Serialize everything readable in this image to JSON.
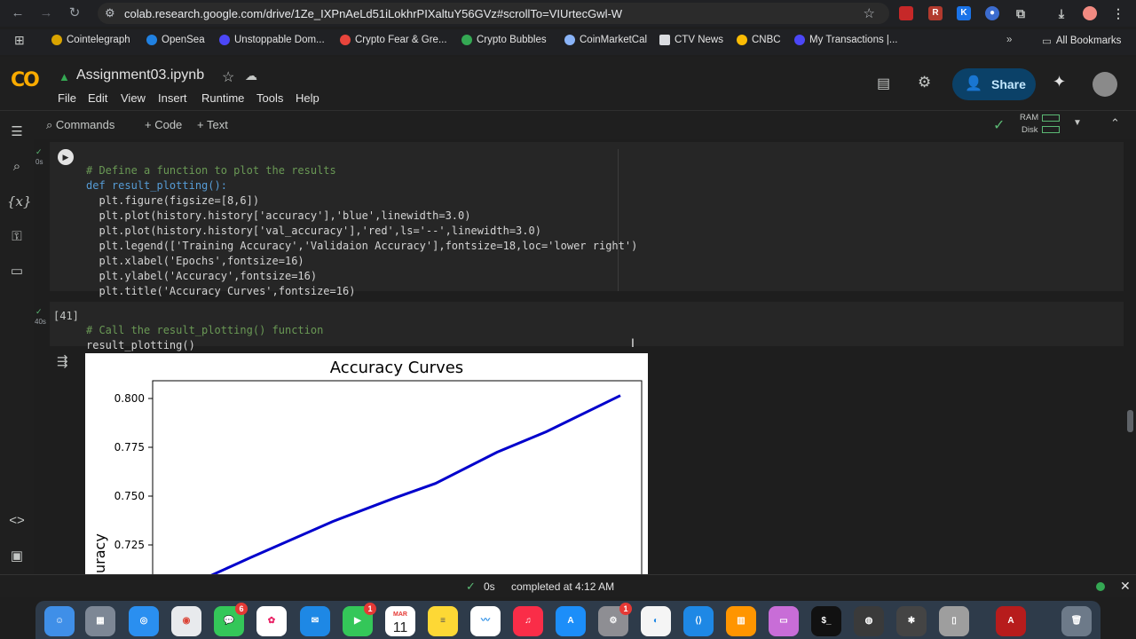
{
  "browser": {
    "url": "colab.research.google.com/drive/1Ze_IXPnAeLd51iLokhrPIXaltuY56GVz#scrollTo=VIUrtecGwl-W",
    "bookmarks": [
      {
        "label": "Cointelegraph",
        "color": "#d9a400"
      },
      {
        "label": "OpenSea",
        "color": "#2081e2"
      },
      {
        "label": "Unstoppable Dom...",
        "color": "#4c47f7"
      },
      {
        "label": "Crypto Fear & Gre...",
        "color": "#e8453c"
      },
      {
        "label": "Crypto Bubbles",
        "color": "#34a853"
      },
      {
        "label": "CoinMarketCal",
        "color": "#8ab4f8"
      },
      {
        "label": "CTV News",
        "color": "#dadce0"
      },
      {
        "label": "CNBC",
        "color": "#fbbc04"
      },
      {
        "label": "My Transactions |...",
        "color": "#4c47f7"
      }
    ],
    "all_bookmarks": "All Bookmarks"
  },
  "colab": {
    "logo": "CO",
    "title": "Assignment03.ipynb",
    "menu": [
      "File",
      "Edit",
      "View",
      "Insert",
      "Runtime",
      "Tools",
      "Help"
    ],
    "share_label": "Share",
    "toolbar": {
      "commands": "Commands",
      "code": "+ Code",
      "text": "+ Text",
      "ram": "RAM",
      "disk": "Disk"
    }
  },
  "cells": [
    {
      "exec_count": "",
      "time": "0s",
      "lines": [
        "# Define a function to plot the results",
        "def result_plotting():",
        "  plt.figure(figsize=[8,6])",
        "  plt.plot(history.history['accuracy'],'blue',linewidth=3.0)",
        "  plt.plot(history.history['val_accuracy'],'red',ls='--',linewidth=3.0)",
        "  plt.legend(['Training Accuracy','Validaion Accuracy'],fontsize=18,loc='lower right')",
        "  plt.xlabel('Epochs',fontsize=16)",
        "  plt.ylabel('Accuracy',fontsize=16)",
        "  plt.title('Accuracy Curves',fontsize=16)"
      ]
    },
    {
      "exec_count": "[41]",
      "time": "40s",
      "lines": [
        "# Call the result_plotting() function",
        "result_plotting()"
      ]
    }
  ],
  "status": {
    "time": "0s",
    "message": "completed at 4:12 AM"
  },
  "dock": {
    "calendar_month": "MAR",
    "calendar_day": "11",
    "messages_badge": "6",
    "facetime_badge": "1",
    "settings_badge": "1"
  },
  "chart_data": {
    "type": "line",
    "title": "Accuracy Curves",
    "ylabel": "uracy",
    "yticks": [
      "0.800",
      "0.775",
      "0.750",
      "0.725"
    ],
    "ylim_visible": [
      0.709,
      0.809
    ],
    "series": [
      {
        "color": "#0000cc",
        "x": [
          0.0,
          0.1,
          0.3,
          0.45,
          0.55,
          0.7,
          0.82,
          1.0
        ],
        "y": [
          0.709,
          0.7185,
          0.737,
          0.749,
          0.7565,
          0.7725,
          0.783,
          0.8015
        ]
      }
    ]
  }
}
